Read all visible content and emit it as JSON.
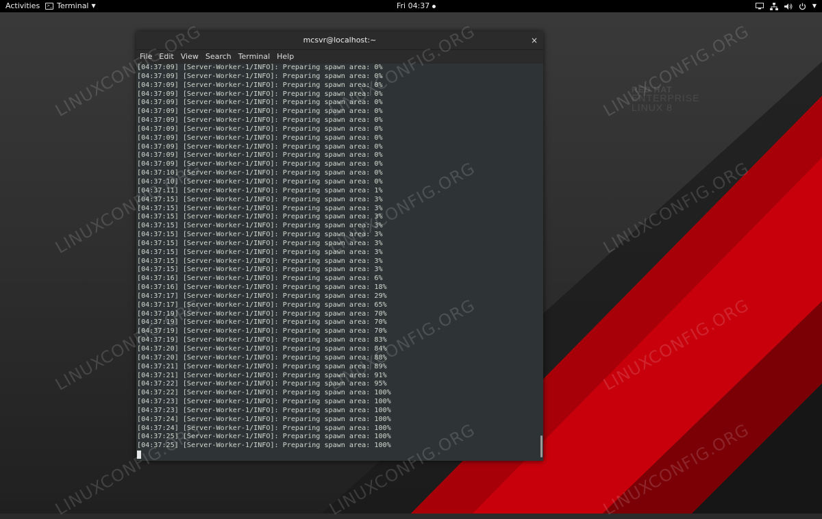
{
  "topbar": {
    "activities": "Activities",
    "app_name": "Terminal",
    "clock": "Fri 04:37"
  },
  "desktop": {
    "watermark": "LINUXCONFIG.ORG",
    "logo_line1": "RED HAT",
    "logo_line2": "ENTERPRISE",
    "logo_line3": "LINUX 8",
    "colors": {
      "red": "#c8000b",
      "dark_red": "#7a0006",
      "background": "#2b2b2b"
    }
  },
  "window": {
    "title": "mcsvr@localhost:~",
    "close": "×",
    "menu": [
      "File",
      "Edit",
      "View",
      "Search",
      "Terminal",
      "Help"
    ]
  },
  "terminal": {
    "lines": [
      "[04:37:09] [Server-Worker-1/INFO]: Preparing spawn area: 0%",
      "[04:37:09] [Server-Worker-1/INFO]: Preparing spawn area: 0%",
      "[04:37:09] [Server-Worker-1/INFO]: Preparing spawn area: 0%",
      "[04:37:09] [Server-Worker-1/INFO]: Preparing spawn area: 0%",
      "[04:37:09] [Server-Worker-1/INFO]: Preparing spawn area: 0%",
      "[04:37:09] [Server-Worker-1/INFO]: Preparing spawn area: 0%",
      "[04:37:09] [Server-Worker-1/INFO]: Preparing spawn area: 0%",
      "[04:37:09] [Server-Worker-1/INFO]: Preparing spawn area: 0%",
      "[04:37:09] [Server-Worker-1/INFO]: Preparing spawn area: 0%",
      "[04:37:09] [Server-Worker-1/INFO]: Preparing spawn area: 0%",
      "[04:37:09] [Server-Worker-1/INFO]: Preparing spawn area: 0%",
      "[04:37:09] [Server-Worker-1/INFO]: Preparing spawn area: 0%",
      "[04:37:10] [Server-Worker-1/INFO]: Preparing spawn area: 0%",
      "[04:37:10] [Server-Worker-1/INFO]: Preparing spawn area: 0%",
      "[04:37:11] [Server-Worker-1/INFO]: Preparing spawn area: 1%",
      "[04:37:15] [Server-Worker-1/INFO]: Preparing spawn area: 3%",
      "[04:37:15] [Server-Worker-1/INFO]: Preparing spawn area: 3%",
      "[04:37:15] [Server-Worker-1/INFO]: Preparing spawn area: 3%",
      "[04:37:15] [Server-Worker-1/INFO]: Preparing spawn area: 3%",
      "[04:37:15] [Server-Worker-1/INFO]: Preparing spawn area: 3%",
      "[04:37:15] [Server-Worker-1/INFO]: Preparing spawn area: 3%",
      "[04:37:15] [Server-Worker-1/INFO]: Preparing spawn area: 3%",
      "[04:37:15] [Server-Worker-1/INFO]: Preparing spawn area: 3%",
      "[04:37:15] [Server-Worker-1/INFO]: Preparing spawn area: 3%",
      "[04:37:16] [Server-Worker-1/INFO]: Preparing spawn area: 6%",
      "[04:37:16] [Server-Worker-1/INFO]: Preparing spawn area: 18%",
      "[04:37:17] [Server-Worker-1/INFO]: Preparing spawn area: 29%",
      "[04:37:17] [Server-Worker-1/INFO]: Preparing spawn area: 65%",
      "[04:37:19] [Server-Worker-1/INFO]: Preparing spawn area: 70%",
      "[04:37:19] [Server-Worker-1/INFO]: Preparing spawn area: 70%",
      "[04:37:19] [Server-Worker-1/INFO]: Preparing spawn area: 70%",
      "[04:37:19] [Server-Worker-1/INFO]: Preparing spawn area: 83%",
      "[04:37:20] [Server-Worker-1/INFO]: Preparing spawn area: 84%",
      "[04:37:20] [Server-Worker-1/INFO]: Preparing spawn area: 88%",
      "[04:37:21] [Server-Worker-1/INFO]: Preparing spawn area: 89%",
      "[04:37:21] [Server-Worker-1/INFO]: Preparing spawn area: 91%",
      "[04:37:22] [Server-Worker-1/INFO]: Preparing spawn area: 95%",
      "[04:37:22] [Server-Worker-1/INFO]: Preparing spawn area: 100%",
      "[04:37:23] [Server-Worker-1/INFO]: Preparing spawn area: 100%",
      "[04:37:23] [Server-Worker-1/INFO]: Preparing spawn area: 100%",
      "[04:37:24] [Server-Worker-1/INFO]: Preparing spawn area: 100%",
      "[04:37:24] [Server-Worker-1/INFO]: Preparing spawn area: 100%",
      "[04:37:25] [Server-Worker-1/INFO]: Preparing spawn area: 100%",
      "[04:37:25] [Server-Worker-1/INFO]: Preparing spawn area: 100%"
    ]
  }
}
